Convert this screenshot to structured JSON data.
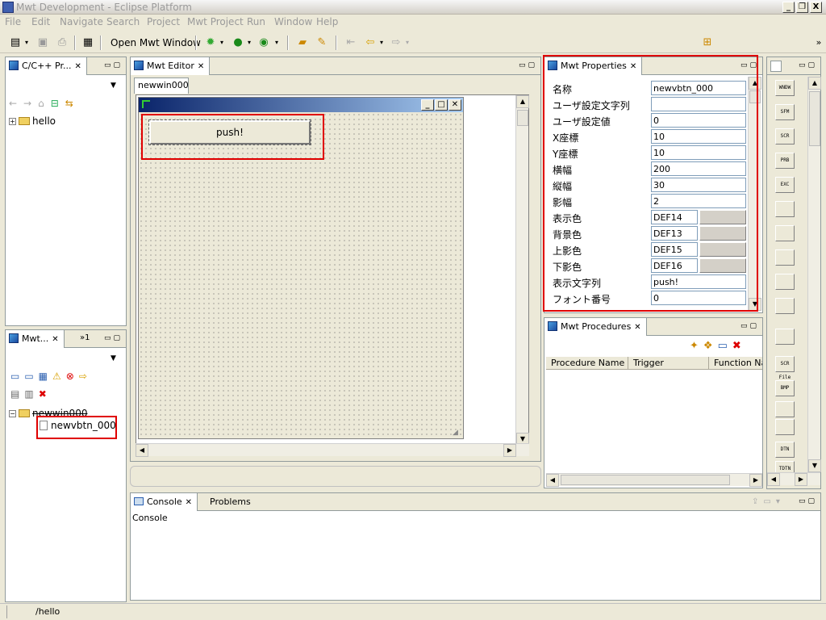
{
  "window": {
    "title": "Mwt Development - Eclipse Platform",
    "controls": [
      "_",
      "❐",
      "X"
    ]
  },
  "menu": [
    "File",
    "Edit",
    "Navigate",
    "Search",
    "Project",
    "Mwt Project",
    "Run",
    "Window",
    "Help"
  ],
  "toolbar": {
    "open_mwt_window": "Open Mwt Window"
  },
  "cpp_view": {
    "tab": "C/C++ Pr...",
    "project": "hello"
  },
  "mwt_view": {
    "tab": "Mwt...",
    "overflow": "»1",
    "root": "newwin000",
    "child": "newvbtn_000"
  },
  "editor": {
    "tab": "Mwt Editor",
    "subtab": "newwin000",
    "button_label": "push!"
  },
  "properties": {
    "tab": "Mwt Properties",
    "rows": [
      {
        "key": "名称",
        "value": "newvbtn_000"
      },
      {
        "key": "ユーザ設定文字列",
        "value": ""
      },
      {
        "key": "ユーザ設定値",
        "value": "0"
      },
      {
        "key": "X座標",
        "value": "10"
      },
      {
        "key": "Y座標",
        "value": "10"
      },
      {
        "key": "横幅",
        "value": "200"
      },
      {
        "key": "縦幅",
        "value": "30"
      },
      {
        "key": "影幅",
        "value": "2"
      },
      {
        "key": "表示色",
        "value": "DEF14"
      },
      {
        "key": "背景色",
        "value": "DEF13"
      },
      {
        "key": "上影色",
        "value": "DEF15"
      },
      {
        "key": "下影色",
        "value": "DEF16"
      },
      {
        "key": "表示文字列",
        "value": "push!"
      },
      {
        "key": "フォント番号",
        "value": "0"
      }
    ]
  },
  "procedures": {
    "tab": "Mwt Procedures",
    "columns": [
      "Procedure Name",
      "Trigger",
      "Function Na"
    ]
  },
  "palette": [
    "WNDW",
    "SFM",
    "SCR",
    "PRB",
    "EXC",
    "",
    "",
    "",
    "",
    "",
    "",
    "SCR\nFile",
    "BMP",
    "",
    "",
    "DTN",
    "TDTN"
  ],
  "console": {
    "tab": "Console",
    "tab2": "Problems",
    "label": "Console"
  },
  "status": {
    "path": "/hello"
  },
  "colors": {
    "highlight": "#e00000",
    "editor_title": "#0a246a"
  }
}
